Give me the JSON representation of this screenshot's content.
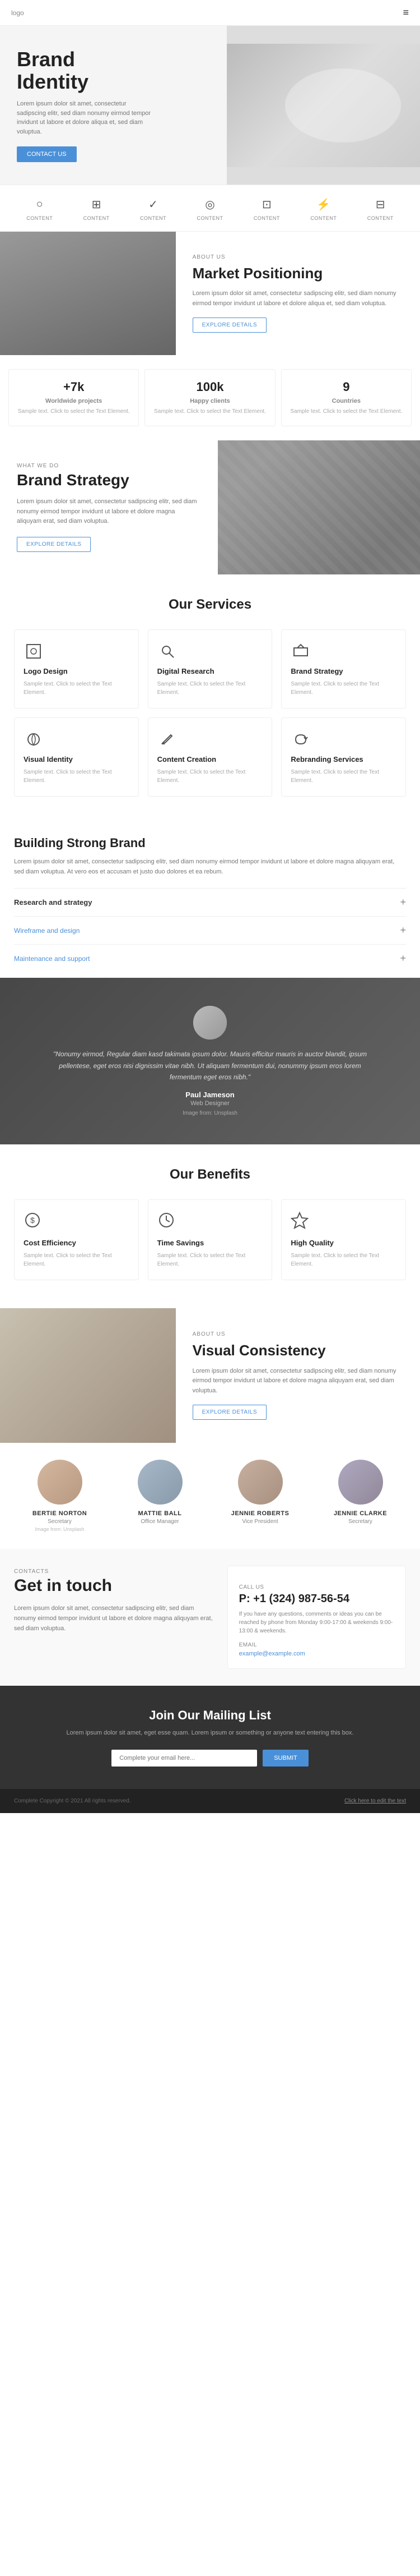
{
  "header": {
    "logo": "logo",
    "menu_icon": "≡"
  },
  "hero": {
    "title": "Brand\nIdentity",
    "text": "Lorem ipsum dolor sit amet, consectetur sadipscing elitr, sed diam nonumy eirmod tempor invidunt ut labore et dolore aliqua et, sed diam voluptua.",
    "button_label": "CONTACT US",
    "image_alt": "Brand Identity hero image"
  },
  "icons_row": {
    "items": [
      {
        "label": "CONTENT",
        "icon": "○"
      },
      {
        "label": "CONTENT",
        "icon": "⊞"
      },
      {
        "label": "CONTENT",
        "icon": "✓"
      },
      {
        "label": "CONTENT",
        "icon": "◎"
      },
      {
        "label": "CONTENT",
        "icon": "⊡"
      },
      {
        "label": "CONTENT",
        "icon": "⚡"
      },
      {
        "label": "CONTENT",
        "icon": "⊟"
      }
    ]
  },
  "about": {
    "label": "ABOUT US",
    "title": "Market Positioning",
    "text": "Lorem ipsum dolor sit amet, consectetur sadipscing elitr, sed diam nonumy eirmod tempor invidunt ut labore et dolore aliqua et, sed diam voluptua.",
    "button_label": "EXPLORE DETAILS"
  },
  "stats": [
    {
      "number": "+7k",
      "label": "Worldwide projects",
      "text": "Sample text. Click to select the Text Element."
    },
    {
      "number": "100k",
      "label": "Happy clients",
      "text": "Sample text. Click to select the Text Element."
    },
    {
      "number": "9",
      "label": "Countries",
      "text": "Sample text. Click to select the Text Element."
    }
  ],
  "what_we_do": {
    "label": "WHAT WE DO",
    "title": "Brand Strategy",
    "text": "Lorem ipsum dolor sit amet, consectetur sadipscing elitr, sed diam nonumy eirmod tempor invidunt ut labore et dolore magna aliquyam erat, sed diam voluptua.",
    "button_label": "EXPLORE DETAILS"
  },
  "services": {
    "heading": "Our Services",
    "items": [
      {
        "icon": "⬜",
        "title": "Logo Design",
        "text": "Sample text. Click to select the Text Element."
      },
      {
        "icon": "🔍",
        "title": "Digital Research",
        "text": "Sample text. Click to select the Text Element."
      },
      {
        "icon": "⬜",
        "title": "Brand Strategy",
        "text": "Sample text. Click to select the Text Element."
      },
      {
        "icon": "⬜",
        "title": "Visual Identity",
        "text": "Sample text. Click to select the Text Element."
      },
      {
        "icon": "✏️",
        "title": "Content Creation",
        "text": "Sample text. Click to select the Text Element."
      },
      {
        "icon": "⬜",
        "title": "Rebranding Services",
        "text": "Sample text. Click to select the Text Element."
      }
    ]
  },
  "building": {
    "title": "Building Strong Brand",
    "text": "Lorem ipsum dolor sit amet, consectetur sadipscing elitr, sed diam nonumy eirmod tempor invidunt ut labore et dolore magna aliquyam erat, sed diam voluptua. At vero eos et accusam et justo duo dolores et ea rebum.",
    "accordions": [
      {
        "title": "Research and strategy",
        "expanded": true
      },
      {
        "title": "Wireframe and design",
        "expanded": false
      },
      {
        "title": "Maintenance and support",
        "expanded": false
      }
    ]
  },
  "testimonial": {
    "text": "\"Nonumy eirmod, Regular diam kasd takimata ipsum dolor. Mauris efficitur mauris in auctor blandit, ipsum pellentese, eget eros nisi dignissim vitae nibh. Ut aliquam fermentum dui, nonummy ipsum eros lorem fermentum eget eros nibh.\"",
    "name": "Paul Jameson",
    "role": "Web Designer",
    "source": "Image from: Unsplash"
  },
  "benefits": {
    "heading": "Our Benefits",
    "items": [
      {
        "icon": "💡",
        "title": "Cost Efficiency",
        "text": "Sample text. Click to select the Text Element."
      },
      {
        "icon": "⏱",
        "title": "Time Savings",
        "text": "Sample text. Click to select the Text Element."
      },
      {
        "icon": "⭐",
        "title": "High Quality",
        "text": "Sample text. Click to select the Text Element."
      }
    ]
  },
  "visual_consistency": {
    "label": "ABOUT US",
    "title": "Visual Consistency",
    "text": "Lorem ipsum dolor sit amet, consectetur sadipscing elitr, sed diam nonumy eirmod tempor invidunt ut labore et dolore magna aliquyam erat, sed diam voluptua.",
    "button_label": "EXPLORE DETAILS"
  },
  "team": {
    "members": [
      {
        "name": "BERTIE NORTON",
        "role": "Secretary",
        "source": "Image from: Unsplash"
      },
      {
        "name": "MATTIE BALL",
        "role": "Office Manager",
        "source": ""
      },
      {
        "name": "JENNIE ROBERTS",
        "role": "Vice President",
        "source": ""
      },
      {
        "name": "JENNIE CLARKE",
        "role": "Secretary",
        "source": ""
      }
    ]
  },
  "contact": {
    "label": "CONTACTS",
    "title": "Get in touch",
    "text": "Lorem ipsum dolor sit amet, consectetur sadipscing elitr, sed diam nonumy eirmod tempor invidunt ut labore et dolore magna aliquyam erat, sed diam voluptua.",
    "call_label": "CALL US",
    "phone": "P: +1 (324) 987-56-54",
    "call_desc": "If you have any questions, comments or ideas you can be reached by phone from Monday 9:00-17:00 & weekends 9:00-13:00 & weekends.",
    "email_label": "EMAIL",
    "email": "example@example.com"
  },
  "mailing": {
    "title": "Join Our Mailing List",
    "text": "Lorem ipsum dolor sit amet, eget esse quam. Lorem ipsum or something or anyone text entering this box.",
    "input_placeholder": "Complete your email here...",
    "button_label": "SUBMIT"
  },
  "footer": {
    "left_text": "Complete Copyright © 2021 All rights reserved.",
    "right_link": "Click here to edit the text"
  }
}
